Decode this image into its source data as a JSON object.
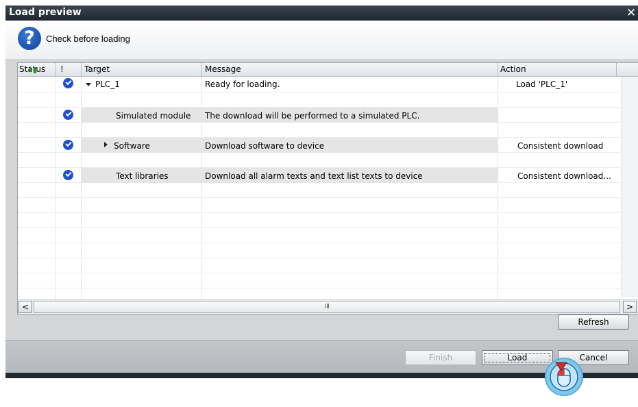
{
  "window": {
    "title": "Load preview"
  },
  "header": {
    "text": "Check before loading"
  },
  "table": {
    "columns": [
      "Status",
      "!",
      "Target",
      "Message",
      "Action"
    ],
    "rows": [
      {
        "target": "PLC_1",
        "message": "Ready for loading.",
        "action": "Load 'PLC_1'"
      },
      {
        "target": "Simulated module",
        "message": "The download will be performed to a simulated PLC.",
        "action": ""
      },
      {
        "target": "Software",
        "message": "Download software to device",
        "action": "Consistent download"
      },
      {
        "target": "Text libraries",
        "message": "Download all alarm texts and text list texts to device",
        "action": "Consistent download..."
      }
    ]
  },
  "scrollbar": {
    "left_arrow": "<",
    "right_arrow": ">",
    "grip": "III"
  },
  "buttons": {
    "refresh": "Refresh",
    "finish": "Finish",
    "load": "Load",
    "cancel": "Cancel"
  },
  "icons": {
    "close": "close-icon",
    "question": "question-icon",
    "check": "check-circle-icon",
    "status": "download-status-icon",
    "cursor": "mouse-cursor-icon"
  },
  "colors": {
    "check": "#1f4fd1",
    "title_bar": "#2a323a",
    "status_icon": "#2e8b2e"
  }
}
